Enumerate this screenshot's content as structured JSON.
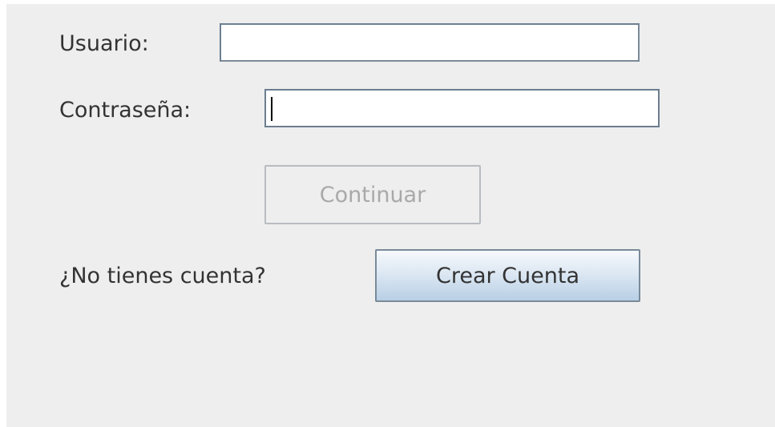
{
  "login": {
    "username_label": "Usuario:",
    "username_value": "",
    "password_label": "Contraseña:",
    "password_value": "",
    "continue_button": "Continuar",
    "no_account_text": "¿No tienes cuenta?",
    "create_account_button": "Crear Cuenta"
  }
}
